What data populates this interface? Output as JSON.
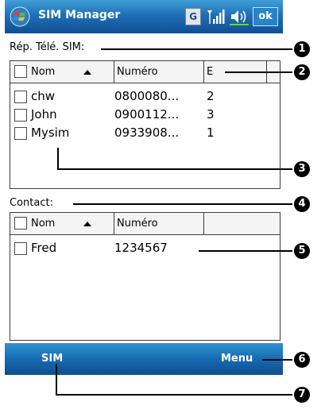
{
  "title_bar": {
    "app_title": "SIM Manager",
    "network_badge": "G",
    "ok_label": "ok",
    "icons": [
      "windows-start-icon",
      "signal-icon",
      "volume-icon"
    ]
  },
  "sim_section": {
    "label": "Rép. Télé. SIM:",
    "columns": [
      "Nom",
      "Numéro",
      "E"
    ],
    "rows": [
      {
        "name": "chw",
        "number": "0800080...",
        "index": "2"
      },
      {
        "name": "John",
        "number": "0900112...",
        "index": "3"
      },
      {
        "name": "Mysim",
        "number": "0933908...",
        "index": "1"
      }
    ]
  },
  "contact_section": {
    "label": "Contact:",
    "columns": [
      "Nom",
      "Numéro"
    ],
    "rows": [
      {
        "name": "Fred",
        "number": "1234567"
      }
    ]
  },
  "menu_bar": {
    "left_softkey": "SIM",
    "right_softkey": "Menu"
  },
  "callouts": [
    "1",
    "2",
    "3",
    "4",
    "5",
    "6",
    "7"
  ],
  "colors": {
    "title_bar": "#1f6fb8",
    "menu_bar": "#176bb2",
    "callout": "#000000"
  }
}
